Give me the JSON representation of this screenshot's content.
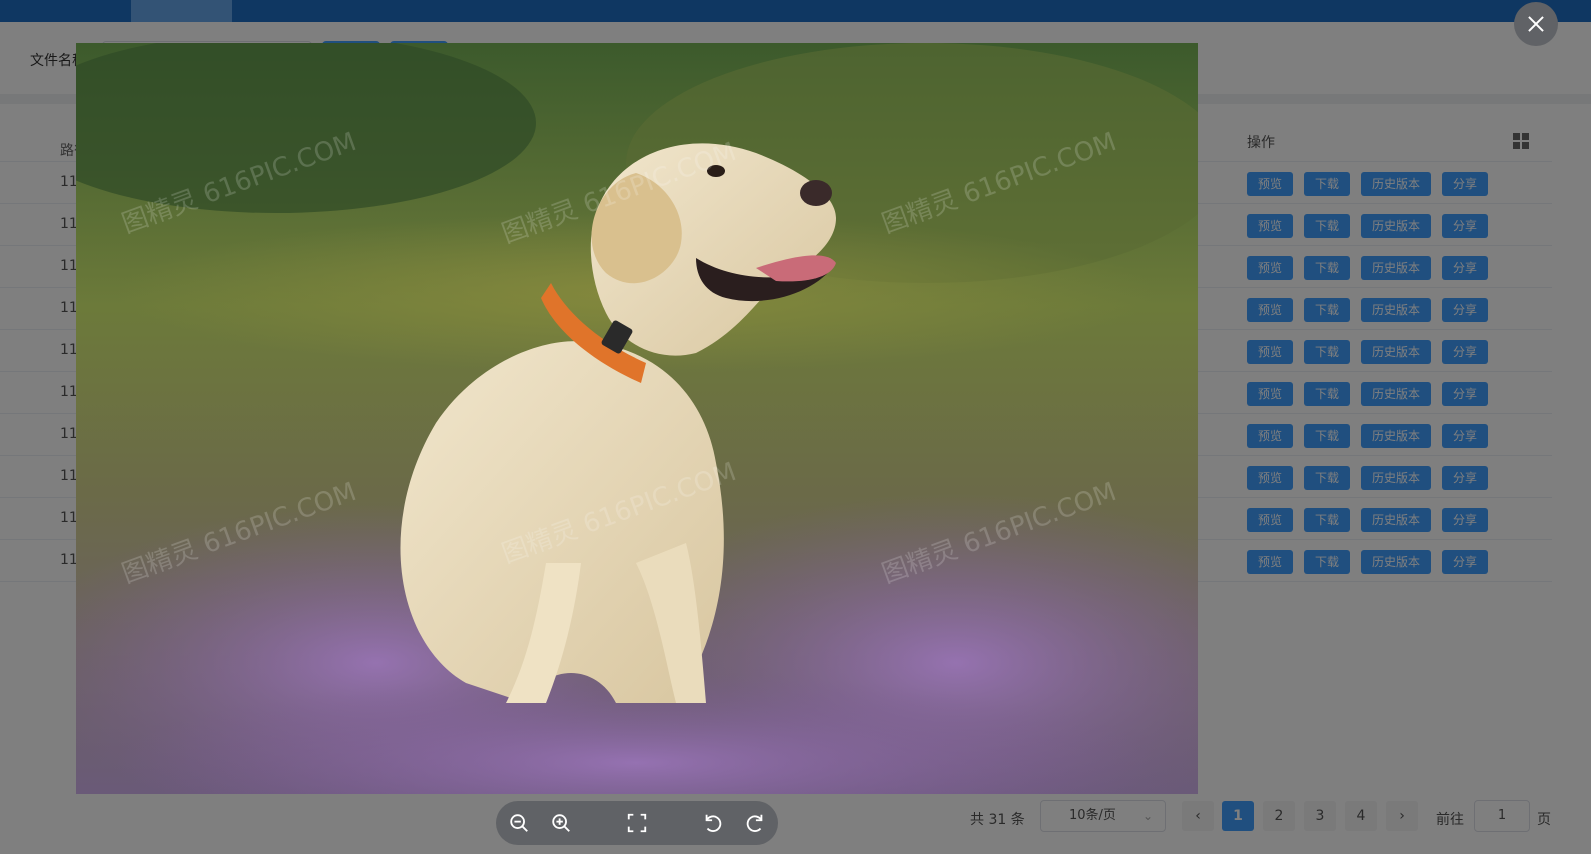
{
  "filter": {
    "label": "文件名称"
  },
  "table": {
    "path_header": "路径",
    "ops_header": "操作",
    "rows": [
      {
        "id": "11"
      },
      {
        "id": "11"
      },
      {
        "id": "11"
      },
      {
        "id": "11"
      },
      {
        "id": "11"
      },
      {
        "id": "11"
      },
      {
        "id": "11"
      },
      {
        "id": "11"
      },
      {
        "id": "11"
      },
      {
        "id": "11"
      }
    ],
    "op_labels": {
      "preview": "预览",
      "download": "下载",
      "history": "历史版本",
      "share": "分享"
    }
  },
  "pagination": {
    "total": "共 31 条",
    "page_size": "10条/页",
    "pages": [
      "1",
      "2",
      "3",
      "4"
    ],
    "current_page": "1",
    "goto_label": "前往",
    "goto_value": "1",
    "page_unit": "页",
    "prev": "‹",
    "next": "›"
  },
  "viewer": {
    "watermark": "图精灵 616PIC.COM",
    "tools": [
      "zoom-out",
      "zoom-in",
      "fit-screen",
      "rotate-left",
      "rotate-right"
    ]
  },
  "colors": {
    "primary": "#409eff",
    "topbar": "#1f6fc4",
    "overlay": "rgba(0,0,0,0.5)",
    "toolbar": "#606266"
  }
}
